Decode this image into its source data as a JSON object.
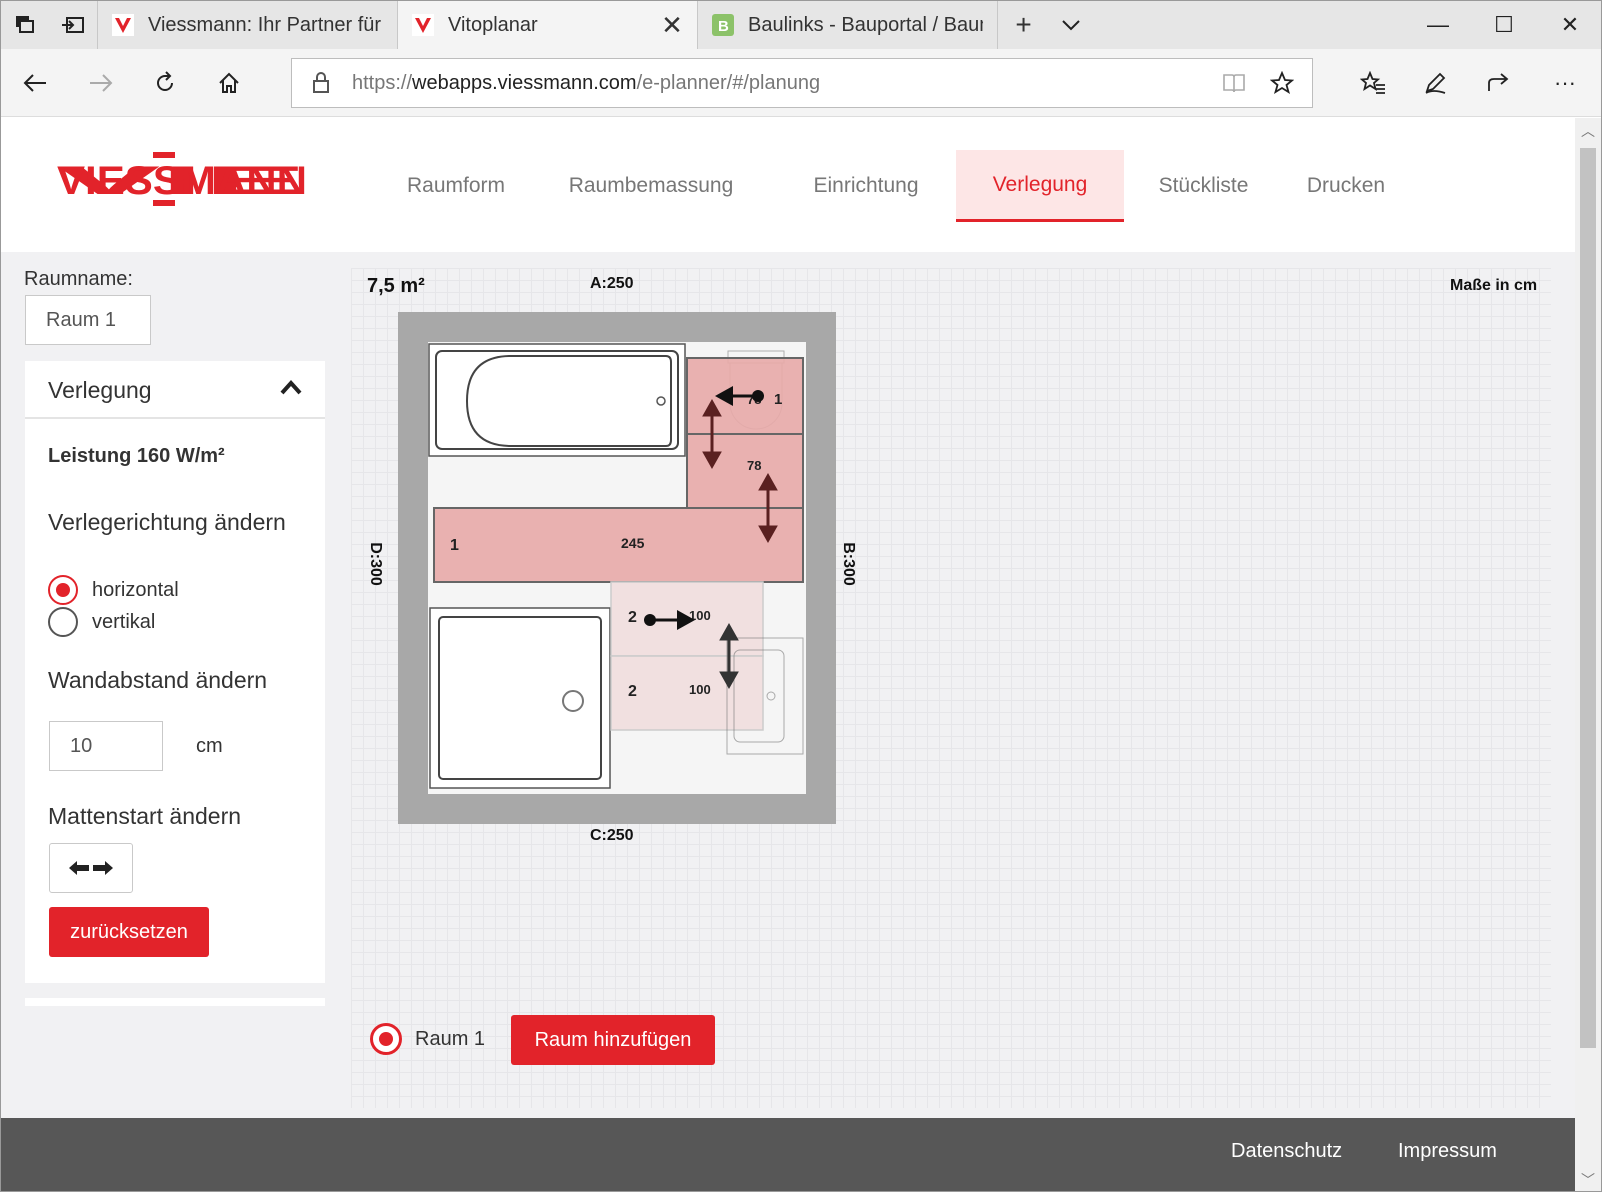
{
  "browser": {
    "tabs": [
      {
        "title": "Viessmann: Ihr Partner für S",
        "active": false
      },
      {
        "title": "Vitoplanar",
        "active": true
      },
      {
        "title": "Baulinks - Bauportal / Baum",
        "active": false
      }
    ],
    "url_prefix": "https://",
    "url_host": "webapps.viessmann.com",
    "url_path": "/e-planner/#/planung"
  },
  "app": {
    "logo_text": "VIESSMANN",
    "nav": [
      "Raumform",
      "Raumbemassung",
      "Einrichtung",
      "Verlegung",
      "Stückliste",
      "Drucken"
    ],
    "active_nav": "Verlegung"
  },
  "sidebar": {
    "room_name_label": "Raumname:",
    "room_name_value": "Raum 1",
    "panel_title": "Verlegung",
    "leistung": "Leistung 160 W/m²",
    "direction_title": "Verlegerichtung ändern",
    "direction_options": [
      "horizontal",
      "vertikal"
    ],
    "direction_selected": "horizontal",
    "wall_distance_title": "Wandabstand ändern",
    "wall_distance_value": "10",
    "wall_distance_unit": "cm",
    "mat_start_title": "Mattenstart ändern",
    "reset_button": "zurücksetzen"
  },
  "canvas": {
    "area": "7,5 m²",
    "units_note": "Maße in cm",
    "side_a": "A:250",
    "side_b": "B:300",
    "side_c": "C:250",
    "side_d": "D:300",
    "mats": [
      {
        "id": "mat-top-small",
        "num": "1",
        "length": "78"
      },
      {
        "id": "mat-top-mid",
        "num": "",
        "length": "78"
      },
      {
        "id": "mat-long",
        "num": "1",
        "length": "245"
      },
      {
        "id": "mat-lower-a",
        "num": "2",
        "length": "100"
      },
      {
        "id": "mat-lower-b",
        "num": "2",
        "length": "100"
      }
    ]
  },
  "rooms": {
    "items": [
      "Raum 1"
    ],
    "add_button": "Raum hinzufügen"
  },
  "footer": {
    "links": [
      "Datenschutz",
      "Impressum"
    ]
  },
  "colors": {
    "brand_red": "#e2232a",
    "mat_fill": "#e8aaa8",
    "mat_light": "#f1dede"
  }
}
